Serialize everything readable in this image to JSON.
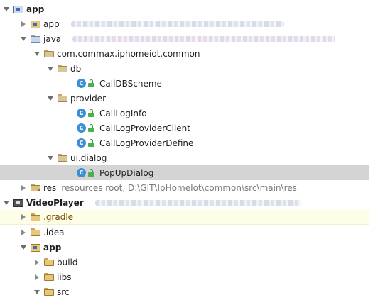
{
  "tree": {
    "app_root": {
      "label": "app"
    },
    "app_module": {
      "label": "app"
    },
    "java": {
      "label": "java"
    },
    "package_common": {
      "label": "com.commax.iphomeiot.common"
    },
    "db": {
      "label": "db"
    },
    "call_db_scheme": {
      "label": "CallDBScheme"
    },
    "provider": {
      "label": "provider"
    },
    "call_log_info": {
      "label": "CallLogInfo"
    },
    "call_log_provider_client": {
      "label": "CallLogProviderClient"
    },
    "call_log_provider_define": {
      "label": "CallLogProviderDefine"
    },
    "ui_dialog": {
      "label": "ui.dialog"
    },
    "popup_dialog": {
      "label": "PopUpDialog"
    },
    "res": {
      "label": "res",
      "description": "resources root,  D:\\GIT\\IpHomeIot\\common\\src\\main\\res"
    },
    "video_player": {
      "label": "VideoPlayer"
    },
    "gradle": {
      "label": ".gradle"
    },
    "idea": {
      "label": ".idea"
    },
    "vp_app": {
      "label": "app"
    },
    "build": {
      "label": "build"
    },
    "libs": {
      "label": "libs"
    },
    "src": {
      "label": "src"
    }
  },
  "icons": {
    "class_letter": "C",
    "class_color": "#3c8fd6",
    "access_color": "#4caf50"
  },
  "selection": {
    "selected_item": "PopUpDialog"
  }
}
